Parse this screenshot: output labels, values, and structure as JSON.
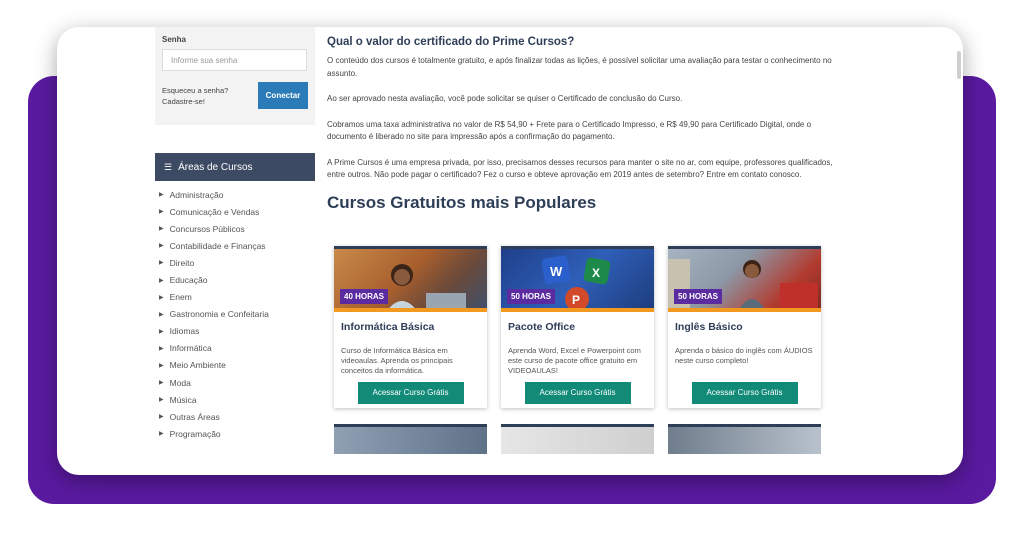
{
  "login": {
    "password_label": "Senha",
    "password_placeholder": "Informe sua senha",
    "forgot_link": "Esqueceu a senha?",
    "signup_link": "Cadastre-se!",
    "connect_button": "Conectar"
  },
  "sidebar": {
    "title": "Áreas de Cursos",
    "items": [
      "Administração",
      "Comunicação e Vendas",
      "Concursos Públicos",
      "Contabilidade e Finanças",
      "Direito",
      "Educação",
      "Enem",
      "Gastronomia e Confeitaria",
      "Idiomas",
      "Informática",
      "Meio Ambiente",
      "Moda",
      "Música",
      "Outras Áreas",
      "Programação"
    ]
  },
  "main": {
    "question_title": "Qual o valor do certificado do Prime Cursos?",
    "p1": "O conteúdo dos cursos é totalmente gratuito, e após finalizar todas as lições, é possível solicitar uma avaliação para testar o conhecimento no assunto.",
    "p2": "Ao ser aprovado nesta avaliação, você pode solicitar se quiser o Certificado de conclusão do Curso.",
    "p3": "Cobramos uma taxa administrativa no valor de R$ 54,90 + Frete para o Certificado Impresso, e R$ 49,90 para Certificado Digital, onde o documento é liberado no site para impressão após a confirmação do pagamento.",
    "p4": "A Prime Cursos é uma empresa privada, por isso, precisamos desses recursos para manter o site no ar, com equipe, professores qualificados, entre outros. Não pode pagar o certificado? Fez o curso e obteve aprovação em 2019 antes de setembro? Entre em contato conosco.",
    "popular_title": "Cursos Gratuitos mais Populares"
  },
  "courses": [
    {
      "hours": "40 HORAS",
      "title": "Informática Básica",
      "description": "Curso de Informática Básica em videoaulas. Aprenda os principais conceitos da informática.",
      "button": "Acessar Curso Grátis"
    },
    {
      "hours": "50 HORAS",
      "title": "Pacote Office",
      "description": "Aprenda Word, Excel e Powerpoint com este curso de pacote office gratuito em VIDEOAULAS!",
      "button": "Acessar Curso Grátis"
    },
    {
      "hours": "50 HORAS",
      "title": "Inglês Básico",
      "description": "Aprenda o básico do inglês com ÁUDIOS neste curso completo!",
      "button": "Acessar Curso Grátis"
    }
  ],
  "colors": {
    "brand_purple": "#5a1aa0",
    "header_navy": "#2e3e57",
    "accent_orange": "#f29a1f",
    "button_teal": "#118a78",
    "connect_blue": "#2b7bb9"
  }
}
